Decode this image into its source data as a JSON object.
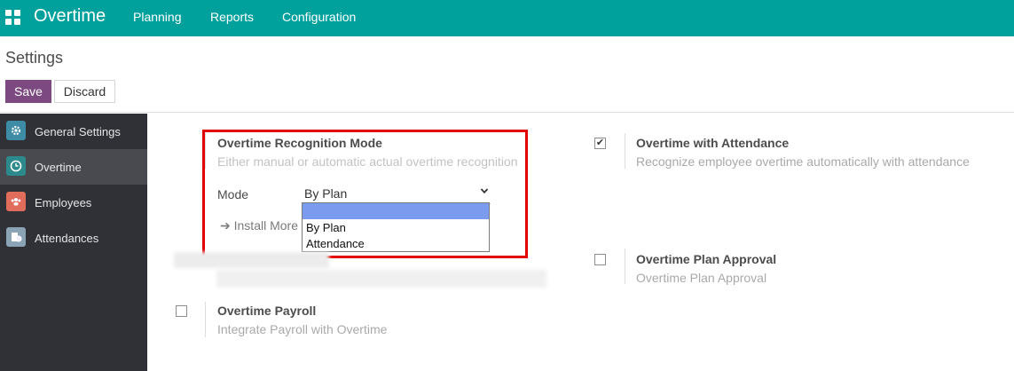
{
  "navbar": {
    "app_name": "Overtime",
    "menu": [
      "Planning",
      "Reports",
      "Configuration"
    ],
    "apps_icon": "grid-icon"
  },
  "control_panel": {
    "title": "Settings",
    "save_label": "Save",
    "discard_label": "Discard"
  },
  "sidebar": {
    "items": [
      {
        "label": "General Settings",
        "icon": "gear-icon",
        "color": "#3e8ba5"
      },
      {
        "label": "Overtime",
        "icon": "clock-icon",
        "color": "#2d8a8c",
        "active": true
      },
      {
        "label": "Employees",
        "icon": "people-icon",
        "color": "#e06c5b"
      },
      {
        "label": "Attendances",
        "icon": "badge-icon",
        "color": "#8aa3b5"
      }
    ]
  },
  "settings": {
    "recognition": {
      "title": "Overtime Recognition Mode",
      "description": "Either manual or automatic actual overtime recognition",
      "mode_label": "Mode",
      "mode_value": "By Plan",
      "options": [
        "",
        "By Plan",
        "Attendance"
      ],
      "install_more": "Install More"
    },
    "attendance": {
      "title": "Overtime with Attendance",
      "description": "Recognize employee overtime automatically with attendance",
      "checked": true
    },
    "plan_approval": {
      "title": "Overtime Plan Approval",
      "description": "Overtime Plan Approval",
      "checked": false
    },
    "payroll": {
      "title": "Overtime Payroll",
      "description": "Integrate Payroll with Overtime",
      "checked": false
    }
  },
  "colors": {
    "navbar": "#00a09d",
    "primary_button": "#7c4a80",
    "sidebar": "#2f3136",
    "highlight_border": "#e00000"
  }
}
